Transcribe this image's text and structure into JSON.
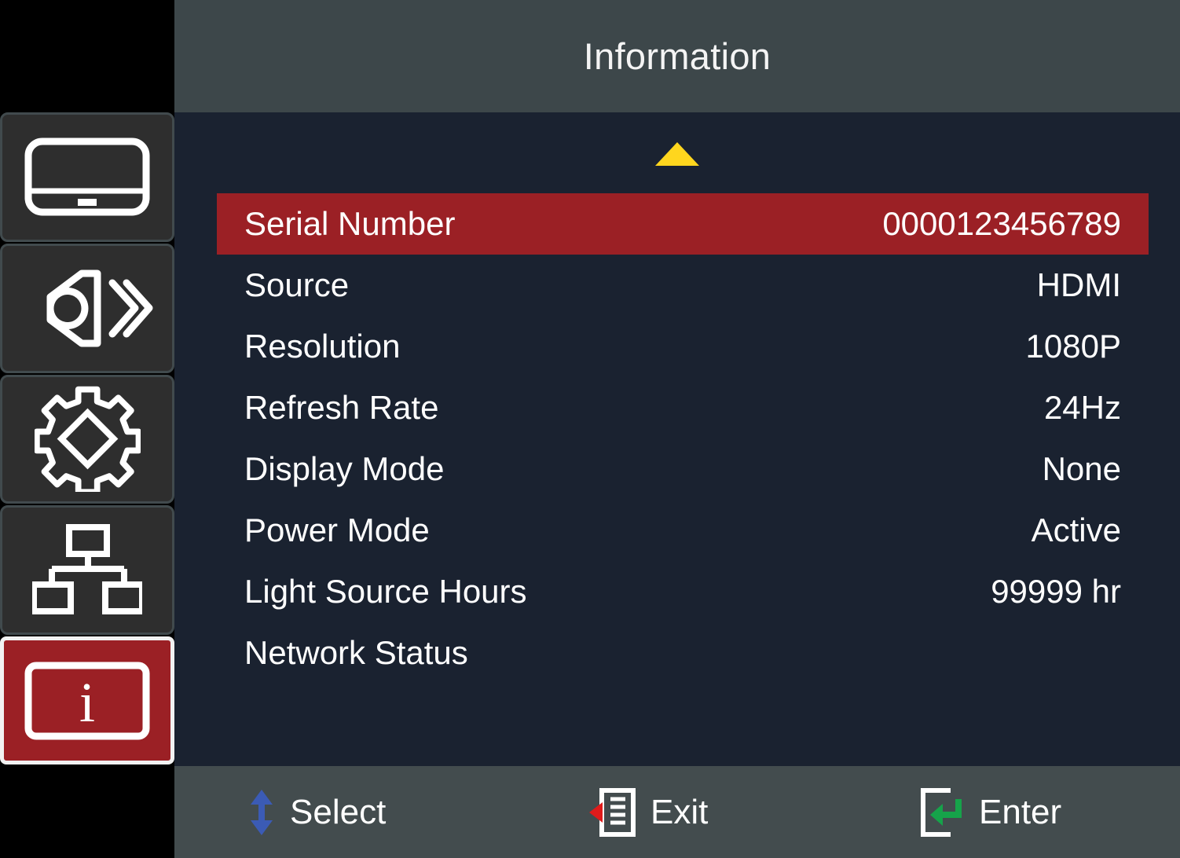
{
  "header": {
    "title": "Information"
  },
  "sidebar": {
    "items": [
      {
        "name": "display-menu",
        "icon": "display-icon",
        "selected": false
      },
      {
        "name": "audio-menu",
        "icon": "speaker-icon",
        "selected": false
      },
      {
        "name": "settings-menu",
        "icon": "gear-icon",
        "selected": false
      },
      {
        "name": "network-menu",
        "icon": "network-tree-icon",
        "selected": false
      },
      {
        "name": "information-menu",
        "icon": "info-icon",
        "selected": true
      }
    ]
  },
  "content": {
    "scroll_up_icon": "triangle-up-icon",
    "scroll_down_icon": "triangle-down-icon",
    "highlight_color": "#9b2025",
    "arrow_color": "#ffd61e",
    "rows": [
      {
        "label": "Serial Number",
        "value": "0000123456789",
        "highlighted": true
      },
      {
        "label": "Source",
        "value": "HDMI",
        "highlighted": false
      },
      {
        "label": "Resolution",
        "value": "1080P",
        "highlighted": false
      },
      {
        "label": "Refresh Rate",
        "value": "24Hz",
        "highlighted": false
      },
      {
        "label": "Display Mode",
        "value": "None",
        "highlighted": false
      },
      {
        "label": "Power Mode",
        "value": "Active",
        "highlighted": false
      },
      {
        "label": "Light Source Hours",
        "value": "99999 hr",
        "highlighted": false
      },
      {
        "label": "Network Status",
        "value": "",
        "highlighted": false
      }
    ]
  },
  "footer": {
    "hints": [
      {
        "label": "Select",
        "icon": "up-down-arrow-icon",
        "color": "#3b5bb5"
      },
      {
        "label": "Exit",
        "icon": "exit-menu-icon",
        "color": "#e01b1b"
      },
      {
        "label": "Enter",
        "icon": "enter-return-icon",
        "color": "#16a34a"
      }
    ]
  }
}
